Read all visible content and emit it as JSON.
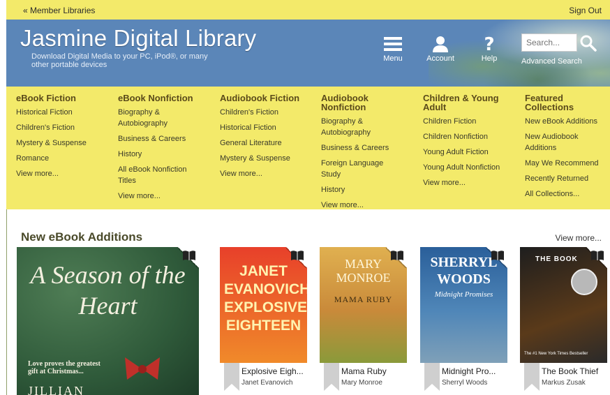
{
  "topbar": {
    "member_link": "« Member Libraries",
    "signout": "Sign Out"
  },
  "header": {
    "brand": "Jasmine Digital Library",
    "tagline": "Download Digital Media to your PC, iPod®, or many other portable devices",
    "menu_label": "Menu",
    "account_label": "Account",
    "help_label": "Help",
    "search_placeholder": "Search...",
    "advanced_search": "Advanced Search"
  },
  "mega_menu": [
    {
      "heading": "eBook Fiction",
      "items": [
        "Historical Fiction",
        "Children's Fiction",
        "Mystery & Suspense",
        "Romance",
        "View more..."
      ]
    },
    {
      "heading": "eBook Nonfiction",
      "items": [
        "Biography & Autobiography",
        "Business & Careers",
        "History",
        "All eBook Nonfiction Titles",
        "View more..."
      ]
    },
    {
      "heading": "Audiobook Fiction",
      "items": [
        "Children's Fiction",
        "Historical Fiction",
        "General Literature",
        "Mystery & Suspense",
        "View more..."
      ]
    },
    {
      "heading": "Audiobook Nonfiction",
      "items": [
        "Biography & Autobiography",
        "Business & Careers",
        "Foreign Language Study",
        "History",
        "View more..."
      ]
    },
    {
      "heading": "Children & Young Adult",
      "items": [
        "Children Fiction",
        "Children Nonfiction",
        "Young Adult Fiction",
        "Young Adult Nonfiction",
        "View more..."
      ]
    },
    {
      "heading": "Featured Collections",
      "items": [
        "New eBook Additions",
        "New Audiobook Additions",
        "May We Recommend",
        "Recently Returned",
        "All Collections..."
      ]
    }
  ],
  "section": {
    "title": "New eBook Additions",
    "view_more": "View more..."
  },
  "books": [
    {
      "title": "",
      "author": "",
      "cover_text": "A Season of the Heart",
      "cover_sub": "Love proves the greatest gift at Christmas...",
      "cover_bottom": "JILLIAN",
      "cover_color": "#2f5a3a"
    },
    {
      "title": "Explosive Eigh...",
      "author": "Janet Evanovich",
      "cover_text": "JANET EVANOVICH EXPLOSIVE EIGHTEEN",
      "cover_color": "#e03a1e"
    },
    {
      "title": "Mama Ruby",
      "author": "Mary Monroe",
      "cover_text": "MARY MONROE",
      "cover_sub": "MAMA RUBY",
      "cover_color": "#d89a3a"
    },
    {
      "title": "Midnight Pro...",
      "author": "Sherryl Woods",
      "cover_text": "SHERRYL WOODS",
      "cover_sub": "Midnight Promises",
      "cover_color": "#3e72a8"
    },
    {
      "title": "The Book Thief",
      "author": "Markus Zusak",
      "cover_text": "THE BOOK",
      "cover_sub": "The #1 New York Times Bestseller",
      "cover_color": "#2a2a2a"
    }
  ],
  "colors": {
    "yellow": "#f3ea6a",
    "header_blue": "#5b86b8"
  },
  "icons": [
    "menu-icon",
    "account-icon",
    "help-icon",
    "search-icon",
    "bookmark-icon"
  ]
}
